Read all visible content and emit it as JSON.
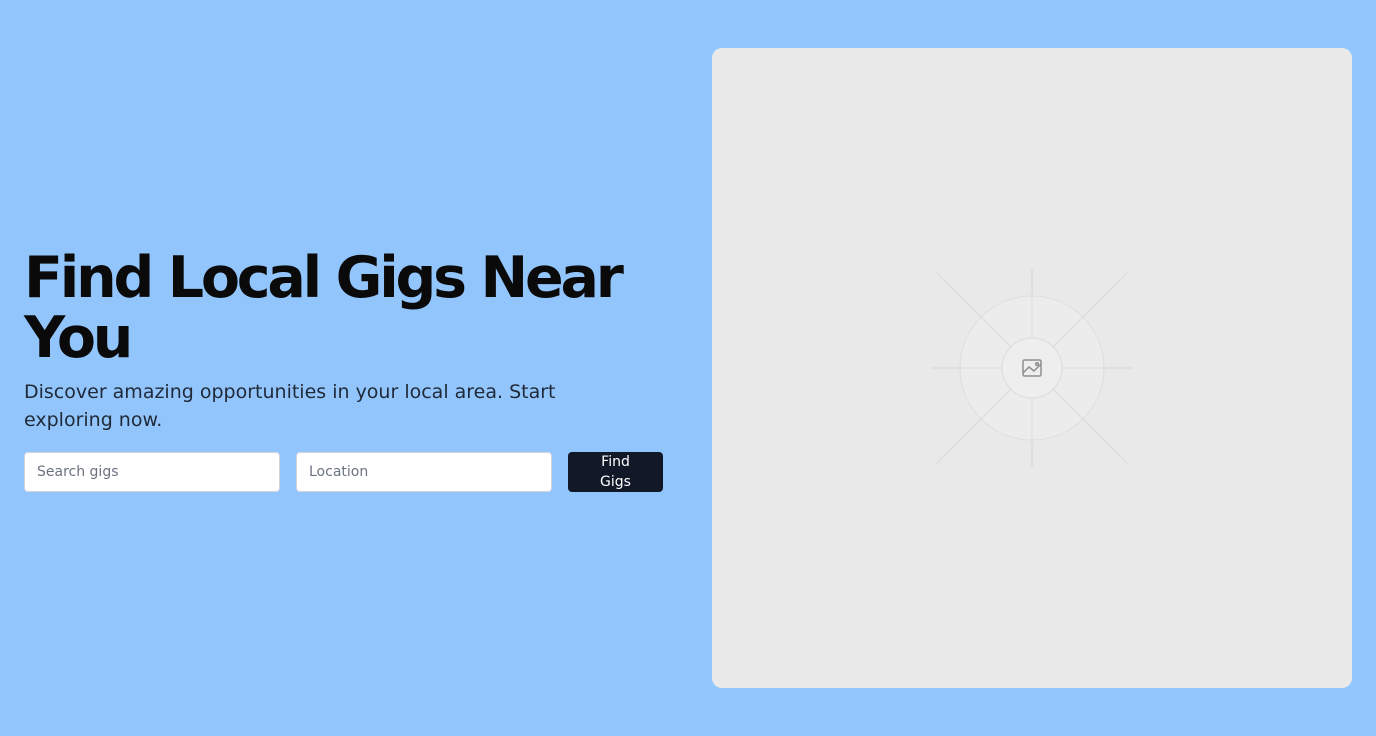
{
  "hero": {
    "title": "Find Local Gigs Near You",
    "subtitle": "Discover amazing opportunities in your local area. Start exploring now."
  },
  "search": {
    "query_placeholder": "Search gigs",
    "location_placeholder": "Location",
    "button_label": "Find Gigs"
  },
  "media": {
    "icon": "image-placeholder-icon"
  },
  "colors": {
    "background": "#93c5fd",
    "button": "#111827",
    "panel": "#e9e9e9"
  }
}
